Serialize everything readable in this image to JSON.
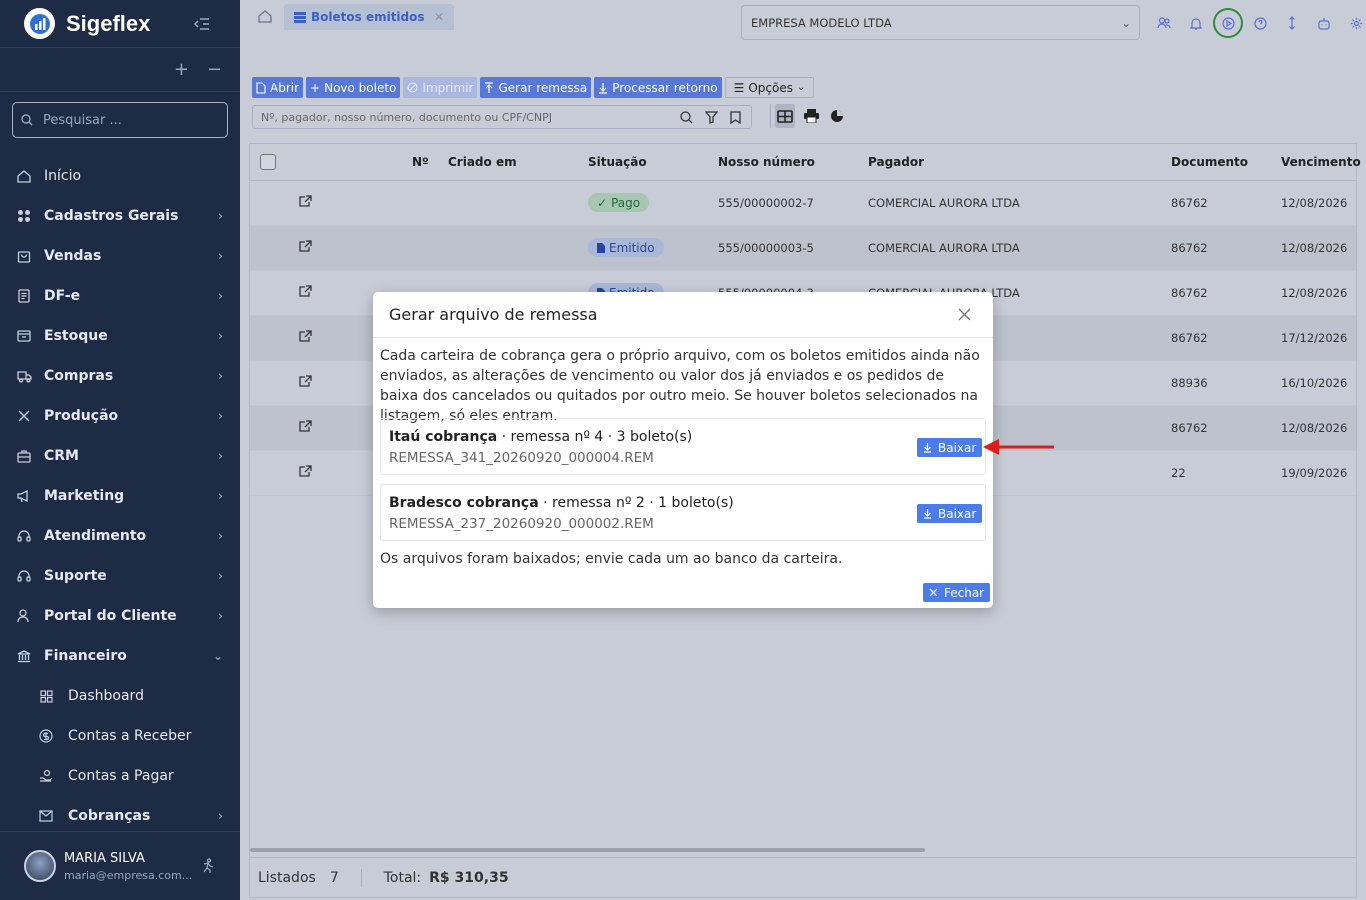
{
  "app": {
    "name": "Sigeflex"
  },
  "sidebar": {
    "search_placeholder": "Pesquisar ...",
    "items": [
      {
        "label": "Início",
        "icon": "home-icon"
      },
      {
        "label": "Cadastros Gerais",
        "icon": "grid-icon"
      },
      {
        "label": "Vendas",
        "icon": "shopping-bag-icon"
      },
      {
        "label": "DF-e",
        "icon": "document-icon"
      },
      {
        "label": "Estoque",
        "icon": "box-icon"
      },
      {
        "label": "Compras",
        "icon": "truck-icon"
      },
      {
        "label": "Produção",
        "icon": "tools-icon"
      },
      {
        "label": "CRM",
        "icon": "briefcase-icon"
      },
      {
        "label": "Marketing",
        "icon": "megaphone-icon"
      },
      {
        "label": "Atendimento",
        "icon": "headset-icon"
      },
      {
        "label": "Suporte",
        "icon": "headset-icon"
      },
      {
        "label": "Portal do Cliente",
        "icon": "user-icon"
      },
      {
        "label": "Financeiro",
        "icon": "bank-icon"
      }
    ],
    "sub_items": [
      {
        "label": "Dashboard",
        "icon": "dashboard-icon"
      },
      {
        "label": "Contas a Receber",
        "icon": "dollar-icon"
      },
      {
        "label": "Contas a Pagar",
        "icon": "hand-money-icon"
      },
      {
        "label": "Cobranças",
        "icon": "envelope-icon"
      }
    ],
    "user": {
      "name": "MARIA SILVA",
      "email": "maria@empresa.com..."
    }
  },
  "topbar": {
    "tab_label": "Boletos emitidos",
    "company": "EMPRESA MODELO LTDA"
  },
  "toolbar": {
    "abrir": "Abrir",
    "novo": "Novo boleto",
    "imprimir": "Imprimir",
    "gerar": "Gerar remessa",
    "processar": "Processar retorno",
    "opcoes": "Opções",
    "filter_placeholder": "Nº, pagador, nosso número, documento ou CPF/CNPJ"
  },
  "table": {
    "headers": {
      "numero": "Nº",
      "criado": "Criado em",
      "situacao": "Situação",
      "nosso": "Nosso número",
      "pagador": "Pagador",
      "documento": "Documento",
      "vencimento": "Vencimento"
    },
    "rows": [
      {
        "situacao": "Pago",
        "nosso": "555/00000002-7",
        "pagador": "COMERCIAL AURORA LTDA",
        "documento": "86762",
        "vencimento": "12/08/2026"
      },
      {
        "situacao": "Emitido",
        "nosso": "555/00000003-5",
        "pagador": "COMERCIAL AURORA LTDA",
        "documento": "86762",
        "vencimento": "12/08/2026"
      },
      {
        "situacao": "Emitido",
        "nosso": "555/00000004-3",
        "pagador": "COMERCIAL AURORA LTDA",
        "documento": "86762",
        "vencimento": "12/08/2026"
      },
      {
        "situacao": "",
        "nosso": "",
        "pagador": "TDA",
        "documento": "86762",
        "vencimento": "17/12/2026"
      },
      {
        "situacao": "",
        "nosso": "",
        "pagador": "S/A",
        "documento": "88936",
        "vencimento": "16/10/2026"
      },
      {
        "situacao": "",
        "nosso": "",
        "pagador": "TDA",
        "documento": "86762",
        "vencimento": "12/08/2026"
      },
      {
        "situacao": "",
        "nosso": "",
        "pagador": "A LTDA",
        "documento": "22",
        "vencimento": "19/09/2026"
      }
    ]
  },
  "footer": {
    "listados_label": "Listados",
    "listados_count": "7",
    "total_label": "Total:",
    "total_value": "R$ 310,35"
  },
  "modal": {
    "title": "Gerar arquivo de remessa",
    "description": "Cada carteira de cobrança gera o próprio arquivo, com os boletos emitidos ainda não enviados, as alterações de vencimento ou valor dos já enviados e os pedidos de baixa dos cancelados ou quitados por outro meio. Se houver boletos selecionados na listagem, só eles entram.",
    "cards": [
      {
        "bank": "Itaú cobrança",
        "info": " · remessa nº 4 · 3 boleto(s)",
        "file": "REMESSA_341_20260920_000004.REM",
        "button": "Baixar"
      },
      {
        "bank": "Bradesco cobrança",
        "info": " · remessa nº 2 · 1 boleto(s)",
        "file": "REMESSA_237_20260920_000002.REM",
        "button": "Baixar"
      }
    ],
    "note": "Os arquivos foram baixados; envie cada um ao banco da carteira.",
    "close_button": "Fechar"
  },
  "colors": {
    "sidebar_bg": "#1e2b45",
    "accent": "#4b7ce8",
    "highlight_ring": "#2e8b3e",
    "arrow": "#e01b1b"
  }
}
